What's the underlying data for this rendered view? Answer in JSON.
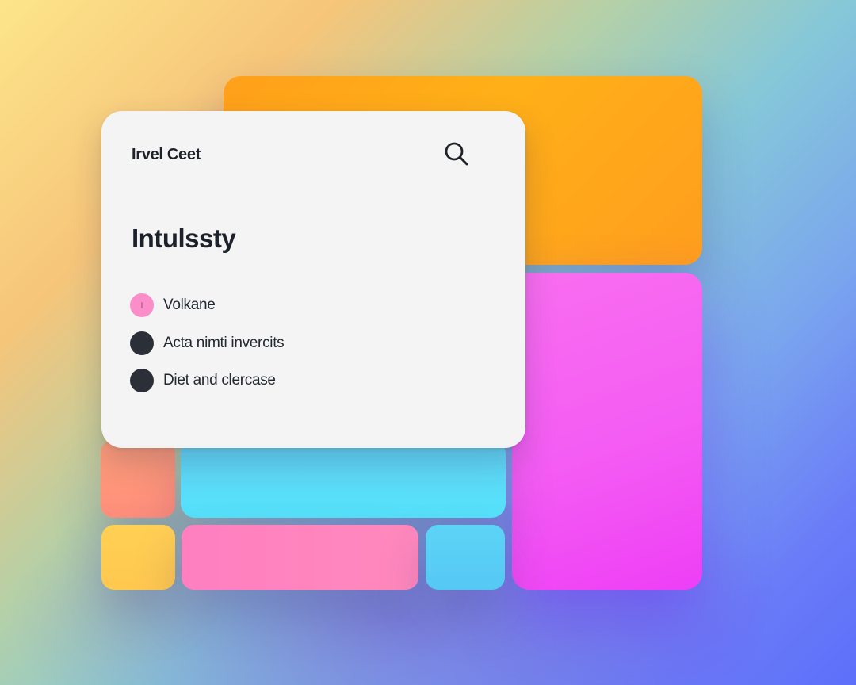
{
  "card": {
    "header_title": "Irvel Ceet",
    "heading": "Intulssty",
    "items": [
      {
        "label": "Volkane",
        "dot_color": "#fb8ec8"
      },
      {
        "label": "Acta nimti invercits",
        "dot_color": "#2a2f38"
      },
      {
        "label": "Diet and clercase",
        "dot_color": "#2a2f38"
      }
    ],
    "search_icon": "search-icon"
  },
  "colors": {
    "orange": "#ffa01a",
    "magenta": "#f45cf3",
    "cyan": "#55e2fa",
    "pink": "#ff7fc0",
    "yellow": "#ffc84f",
    "salmon": "#ff9e78",
    "sky": "#56c8f4",
    "card_bg": "#f4f4f4"
  }
}
